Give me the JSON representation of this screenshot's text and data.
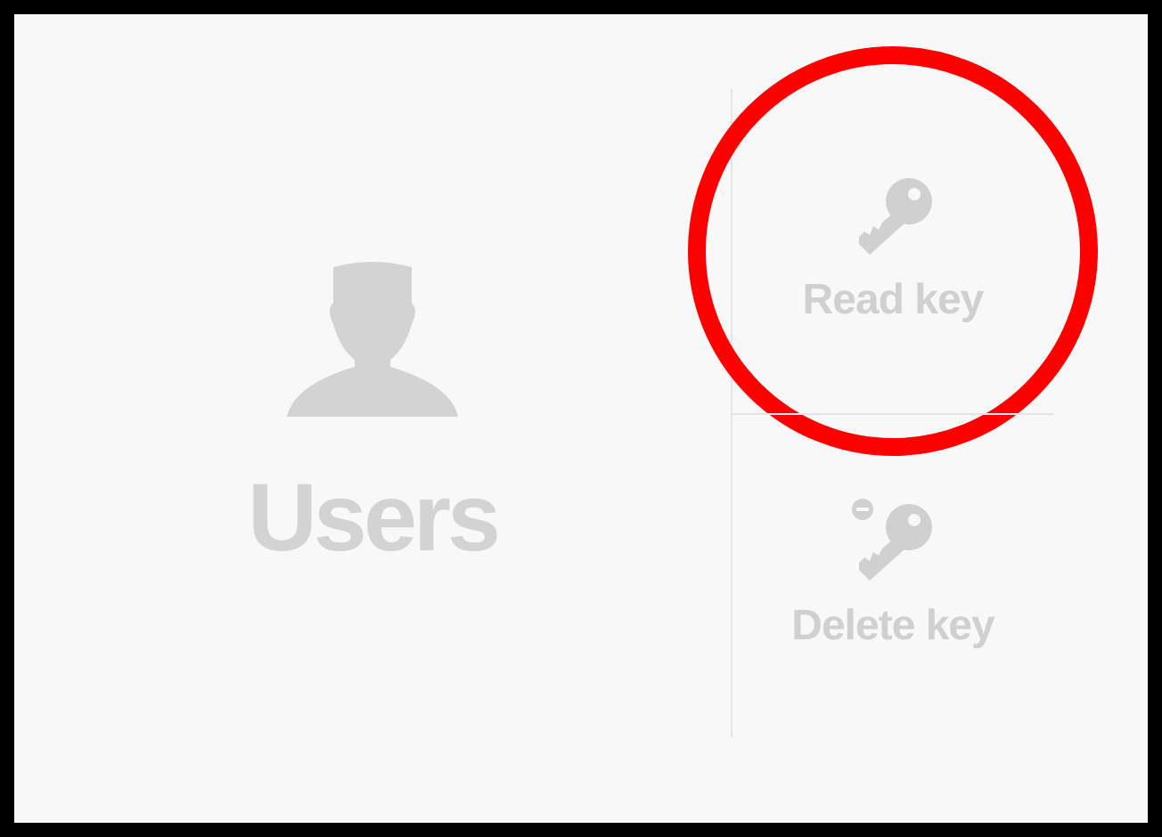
{
  "main": {
    "label": "Users"
  },
  "actions": [
    {
      "label": "Read key",
      "kind": "read",
      "highlighted": true
    },
    {
      "label": "Delete key",
      "kind": "delete",
      "highlighted": false
    }
  ],
  "highlight": {
    "kind": "circle",
    "color": "#ff0000"
  }
}
